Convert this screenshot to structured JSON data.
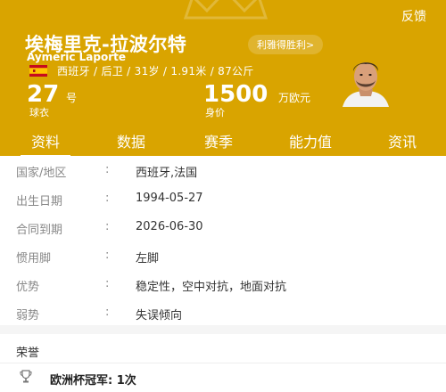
{
  "header": {
    "feedback": "反馈",
    "name_cn": "埃梅里克-拉波尔特",
    "club_pill": "利雅得胜利>",
    "name_en": "Aymeric Laporte",
    "meta": "西班牙 / 后卫 / 31岁 / 1.91米 / 87公斤",
    "shirt_number": "27",
    "shirt_number_unit": "号",
    "shirt_number_label": "球衣",
    "market_value": "1500",
    "market_value_unit": "万欧元",
    "market_value_label": "身价",
    "flag_icon": "spain-flag-icon",
    "avatar_icon": "player-avatar",
    "background_color": "#d9a400"
  },
  "tabs": [
    {
      "label": "资料",
      "active": true
    },
    {
      "label": "数据",
      "active": false
    },
    {
      "label": "赛季",
      "active": false
    },
    {
      "label": "能力值",
      "active": false
    },
    {
      "label": "资讯",
      "active": false
    }
  ],
  "info": {
    "colon": ":",
    "rows": [
      {
        "label": "国家/地区",
        "value": "西班牙,法国"
      },
      {
        "label": "出生日期",
        "value": "1994-05-27"
      },
      {
        "label": "合同到期",
        "value": "2026-06-30"
      },
      {
        "label": "惯用脚",
        "value": "左脚"
      },
      {
        "label": "优势",
        "value": "稳定性，空中对抗，地面对抗"
      },
      {
        "label": "弱势",
        "value": "失误倾向"
      }
    ]
  },
  "honors": {
    "title": "荣誉",
    "items": [
      {
        "icon": "trophy-icon",
        "text": "欧洲杯冠军: 1次"
      }
    ]
  }
}
